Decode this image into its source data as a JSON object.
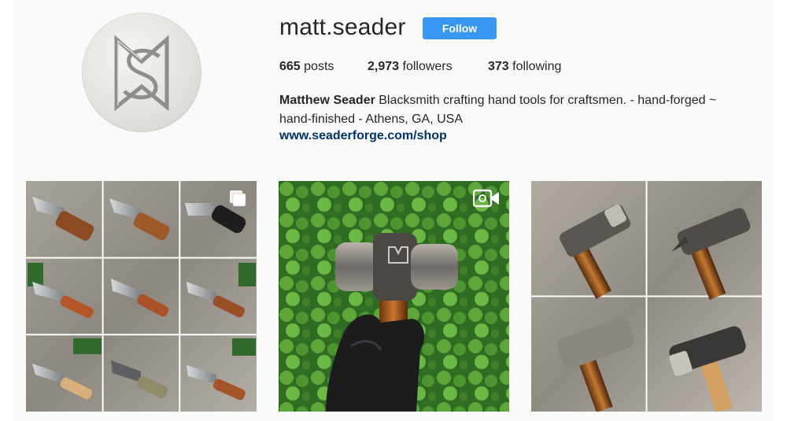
{
  "profile": {
    "username": "matt.seader",
    "follow_label": "Follow",
    "stats": {
      "posts_count": "665",
      "posts_label": " posts",
      "followers_count": "2,973",
      "followers_label": " followers",
      "following_count": "373",
      "following_label": " following"
    },
    "bio": {
      "full_name": "Matthew Seader",
      "text": " Blacksmith crafting hand tools for craftsmen. - hand-forged ~ hand-finished - Athens, GA, USA",
      "link": "www.seaderforge.com/shop"
    }
  },
  "posts": [
    {
      "badge_icon": "multiple-images-icon"
    },
    {
      "badge_icon": "video-camera-icon"
    },
    {
      "badge_icon": "none"
    }
  ],
  "colors": {
    "follow_button": "#3897f0",
    "link": "#003569",
    "text": "#262626",
    "background": "#fafafa"
  }
}
